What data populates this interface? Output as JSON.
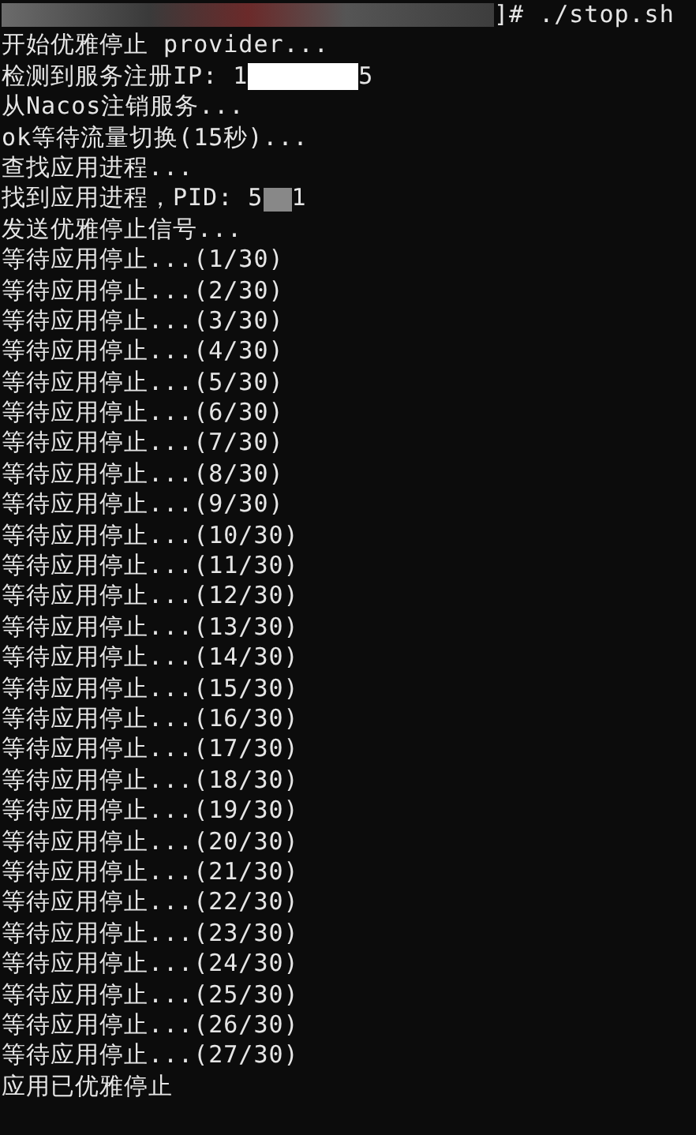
{
  "terminal": {
    "lines": [
      [
        {
          "kind": "blur"
        },
        {
          "kind": "text",
          "text": "]# ./stop.sh"
        }
      ],
      [
        {
          "kind": "text",
          "text": "开始优雅停止 provider..."
        }
      ],
      [
        {
          "kind": "text",
          "text": "检测到服务注册IP: 1"
        },
        {
          "kind": "blur"
        },
        {
          "kind": "text",
          "text": "5"
        }
      ],
      [
        {
          "kind": "text",
          "text": "从Nacos注销服务..."
        }
      ],
      [
        {
          "kind": "text",
          "text": "ok等待流量切换(15秒)..."
        }
      ],
      [
        {
          "kind": "text",
          "text": "查找应用进程..."
        }
      ],
      [
        {
          "kind": "text",
          "text": "找到应用进程，PID: 5"
        },
        {
          "kind": "blur"
        },
        {
          "kind": "text",
          "text": "1"
        }
      ],
      [
        {
          "kind": "text",
          "text": "发送优雅停止信号..."
        }
      ],
      [
        {
          "kind": "text",
          "text": "等待应用停止...(1/30)"
        }
      ],
      [
        {
          "kind": "text",
          "text": "等待应用停止...(2/30)"
        }
      ],
      [
        {
          "kind": "text",
          "text": "等待应用停止...(3/30)"
        }
      ],
      [
        {
          "kind": "text",
          "text": "等待应用停止...(4/30)"
        }
      ],
      [
        {
          "kind": "text",
          "text": "等待应用停止...(5/30)"
        }
      ],
      [
        {
          "kind": "text",
          "text": "等待应用停止...(6/30)"
        }
      ],
      [
        {
          "kind": "text",
          "text": "等待应用停止...(7/30)"
        }
      ],
      [
        {
          "kind": "text",
          "text": "等待应用停止...(8/30)"
        }
      ],
      [
        {
          "kind": "text",
          "text": "等待应用停止...(9/30)"
        }
      ],
      [
        {
          "kind": "text",
          "text": "等待应用停止...(10/30)"
        }
      ],
      [
        {
          "kind": "text",
          "text": "等待应用停止...(11/30)"
        }
      ],
      [
        {
          "kind": "text",
          "text": "等待应用停止...(12/30)"
        }
      ],
      [
        {
          "kind": "text",
          "text": "等待应用停止...(13/30)"
        }
      ],
      [
        {
          "kind": "text",
          "text": "等待应用停止...(14/30)"
        }
      ],
      [
        {
          "kind": "text",
          "text": "等待应用停止...(15/30)"
        }
      ],
      [
        {
          "kind": "text",
          "text": "等待应用停止...(16/30)"
        }
      ],
      [
        {
          "kind": "text",
          "text": "等待应用停止...(17/30)"
        }
      ],
      [
        {
          "kind": "text",
          "text": "等待应用停止...(18/30)"
        }
      ],
      [
        {
          "kind": "text",
          "text": "等待应用停止...(19/30)"
        }
      ],
      [
        {
          "kind": "text",
          "text": "等待应用停止...(20/30)"
        }
      ],
      [
        {
          "kind": "text",
          "text": "等待应用停止...(21/30)"
        }
      ],
      [
        {
          "kind": "text",
          "text": "等待应用停止...(22/30)"
        }
      ],
      [
        {
          "kind": "text",
          "text": "等待应用停止...(23/30)"
        }
      ],
      [
        {
          "kind": "text",
          "text": "等待应用停止...(24/30)"
        }
      ],
      [
        {
          "kind": "text",
          "text": "等待应用停止...(25/30)"
        }
      ],
      [
        {
          "kind": "text",
          "text": "等待应用停止...(26/30)"
        }
      ],
      [
        {
          "kind": "text",
          "text": "等待应用停止...(27/30)"
        }
      ],
      [
        {
          "kind": "text",
          "text": "应用已优雅停止"
        }
      ]
    ]
  }
}
